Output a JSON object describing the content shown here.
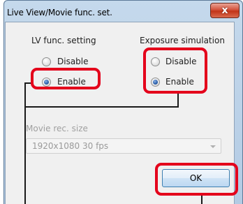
{
  "window": {
    "title": "Live View/Movie func. set.",
    "close_label": "x"
  },
  "lv_func": {
    "heading": "LV func. setting",
    "options": [
      "Disable",
      "Enable"
    ],
    "selected": "Enable"
  },
  "exposure_sim": {
    "heading": "Exposure simulation",
    "options": [
      "Disable",
      "Enable"
    ],
    "selected": "Enable"
  },
  "movie": {
    "heading": "Movie rec. size",
    "selected_value": "1920x1080  30 fps"
  },
  "buttons": {
    "ok_label": "OK"
  },
  "colors": {
    "highlight": "#e4001b",
    "callout_line": "#1a1a1a"
  }
}
